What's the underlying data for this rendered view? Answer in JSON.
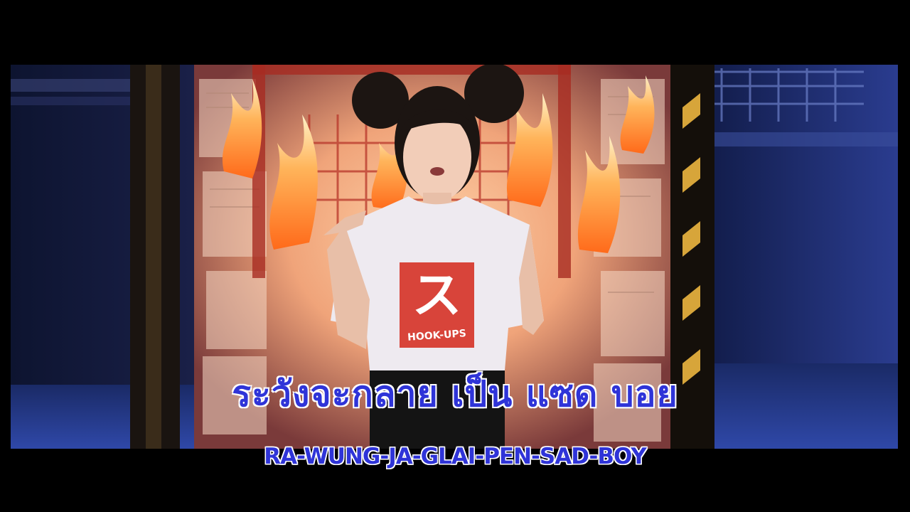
{
  "lyrics": {
    "thai_line": "ระวังจะกลาย เป็น แซด บอย",
    "romanized_line": "RA-WUNG-JA-GLAI-PEN-SAD-BOY"
  },
  "shirt_logo": {
    "glyph": "ス",
    "brand": "HOOK-UPS"
  },
  "colors": {
    "subtitle_fill": "#2f34d8",
    "subtitle_outline": "#ffffff",
    "letterbox": "#000000",
    "fire": "#ff8a2a",
    "ambient_blue": "#1c2a6e"
  }
}
